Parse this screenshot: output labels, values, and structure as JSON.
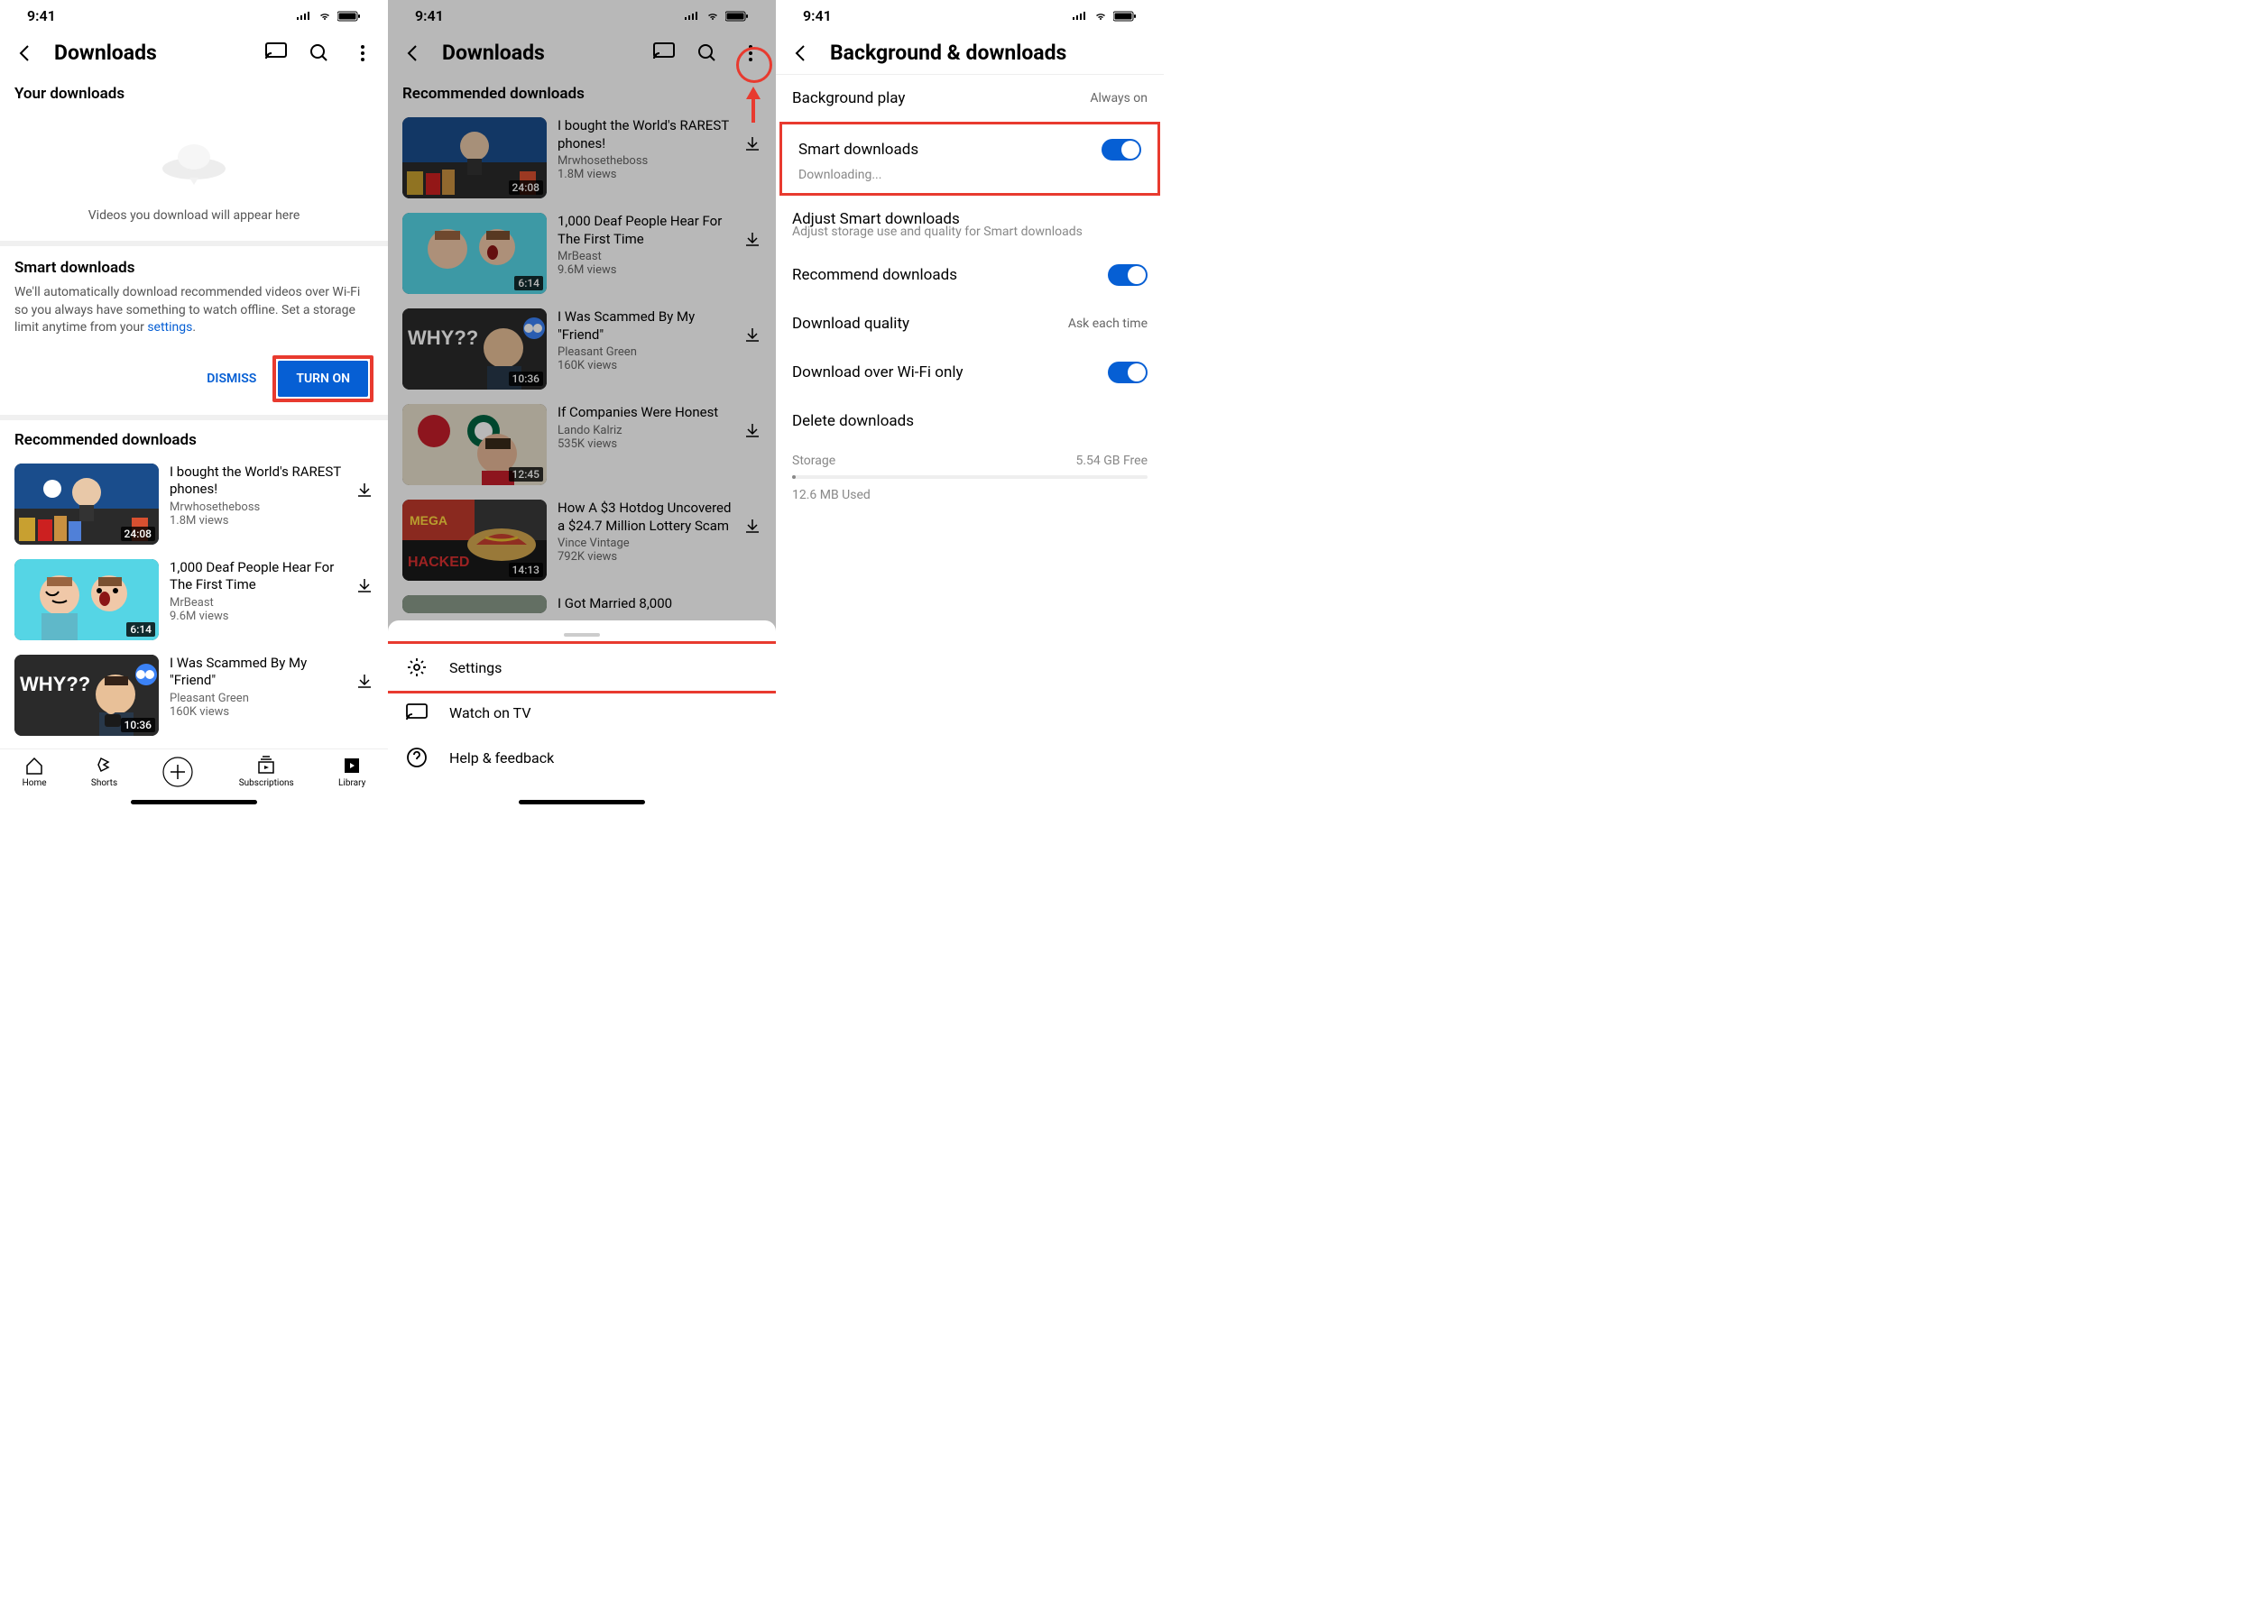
{
  "status": {
    "time": "9:41"
  },
  "screen1": {
    "title": "Downloads",
    "your_downloads": "Your downloads",
    "empty_text": "Videos you download will appear here",
    "smart_title": "Smart downloads",
    "smart_body_pre": "We'll automatically download recommended videos over Wi-Fi so you always have something to watch offline. Set a storage limit anytime from your ",
    "smart_body_link": "settings",
    "dismiss": "DISMISS",
    "turn_on": "TURN ON",
    "rec_header": "Recommended downloads",
    "videos": [
      {
        "title": "I bought the World's RAREST phones!",
        "channel": "Mrwhosetheboss",
        "views": "1.8M views",
        "dur": "24:08"
      },
      {
        "title": "1,000 Deaf People Hear For The First Time",
        "channel": "MrBeast",
        "views": "9.6M views",
        "dur": "6:14"
      },
      {
        "title": "I Was Scammed By My \"Friend\"",
        "channel": "Pleasant Green",
        "views": "160K views",
        "dur": "10:36"
      }
    ],
    "nav": {
      "home": "Home",
      "shorts": "Shorts",
      "subs": "Subscriptions",
      "lib": "Library"
    }
  },
  "screen2": {
    "title": "Downloads",
    "rec_header": "Recommended downloads",
    "videos": [
      {
        "title": "I bought the World's RAREST phones!",
        "channel": "Mrwhosetheboss",
        "views": "1.8M views",
        "dur": "24:08"
      },
      {
        "title": "1,000 Deaf People Hear For The First Time",
        "channel": "MrBeast",
        "views": "9.6M views",
        "dur": "6:14"
      },
      {
        "title": "I Was Scammed By My \"Friend\"",
        "channel": "Pleasant Green",
        "views": "160K views",
        "dur": "10:36"
      },
      {
        "title": "If Companies Were Honest",
        "channel": "Lando Kalriz",
        "views": "535K views",
        "dur": "12:45"
      },
      {
        "title": "How A $3 Hotdog Uncovered a $24.7 Million Lottery Scam",
        "channel": "Vince Vintage",
        "views": "792K views",
        "dur": "14:13"
      },
      {
        "title": "I Got Married 8,000",
        "channel": "",
        "views": "",
        "dur": ""
      }
    ],
    "sheet": {
      "settings": "Settings",
      "watch_tv": "Watch on TV",
      "help": "Help & feedback"
    }
  },
  "screen3": {
    "title": "Background & downloads",
    "rows": {
      "bg_play": {
        "label": "Background play",
        "value": "Always on"
      },
      "smart": {
        "label": "Smart downloads",
        "sub": "Downloading..."
      },
      "adjust": {
        "label": "Adjust Smart downloads",
        "sub": "Adjust storage use and quality for Smart downloads"
      },
      "recommend": {
        "label": "Recommend downloads"
      },
      "quality": {
        "label": "Download quality",
        "value": "Ask each time"
      },
      "wifi": {
        "label": "Download over Wi-Fi only"
      },
      "delete": {
        "label": "Delete downloads"
      }
    },
    "storage": {
      "label": "Storage",
      "free": "5.54 GB Free",
      "used": "12.6 MB Used"
    }
  }
}
